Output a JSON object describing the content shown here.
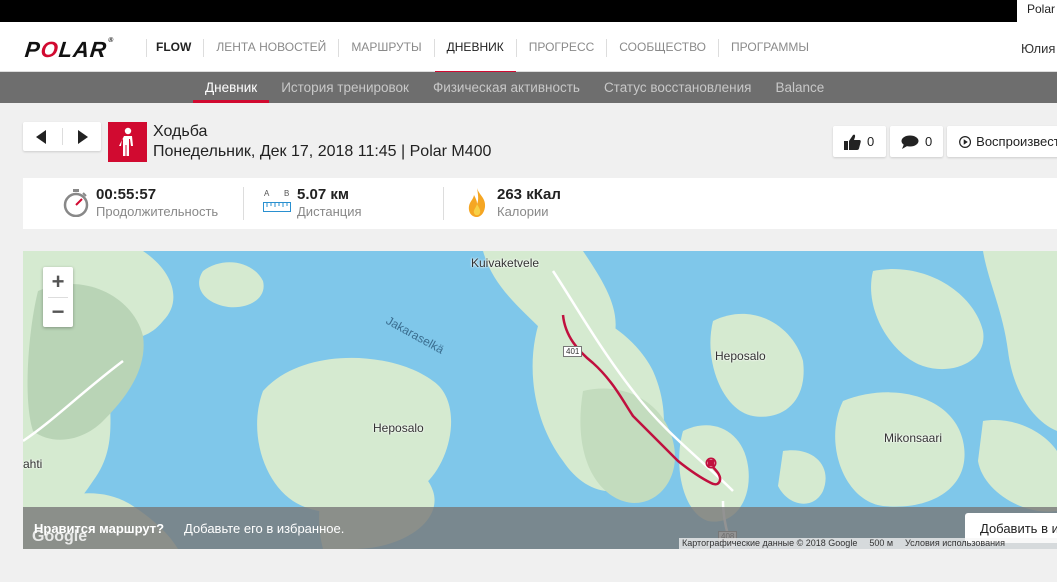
{
  "topbar": {
    "tab_label": "Polar"
  },
  "nav": {
    "brand": "POLAR",
    "items": [
      "FLOW",
      "ЛЕНТА НОВОСТЕЙ",
      "МАРШРУТЫ",
      "ДНЕВНИК",
      "ПРОГРЕСС",
      "СООБЩЕСТВО",
      "ПРОГРАММЫ"
    ],
    "active": "ДНЕВНИК",
    "user": "Юлия"
  },
  "subnav": {
    "items": [
      "Дневник",
      "История тренировок",
      "Физическая активность",
      "Статус восстановления",
      "Balance"
    ],
    "active": "Дневник"
  },
  "session": {
    "sport": "Ходьба",
    "date_device": "Понедельник, Дек 17, 2018 11:45 | Polar M400",
    "likes": "0",
    "comments": "0",
    "play_label": "Воспроизвести"
  },
  "summary": {
    "duration_value": "00:55:57",
    "duration_label": "Продолжительность",
    "distance_icon_a": "A",
    "distance_icon_b": "B",
    "distance_value": "5.07 км",
    "distance_label": "Дистанция",
    "calories_value": "263 кКал",
    "calories_label": "Калории"
  },
  "map": {
    "zoom_in": "+",
    "zoom_out": "−",
    "labels": {
      "kuivaketvele": "Kuivaketvele",
      "jakaraselka": "Jakaraselkä",
      "heposalo_left": "Heposalo",
      "heposalo_right": "Heposalo",
      "mikonsaari": "Mikonsaari",
      "ahti": "ahti",
      "road_top": "401",
      "road_bottom": "408"
    },
    "google_logo": "Google",
    "credit_data": "Картографические данные © 2018 Google",
    "credit_scale": "500 м",
    "credit_terms": "Условия использования",
    "prompt_question": "Нравится маршрут?",
    "prompt_action": "Добавьте его в избранное.",
    "favorite_label": "Добавить в избранное",
    "colors": {
      "water": "#7fc7ea",
      "land": "#d5ead0",
      "route": "#c0103e"
    }
  }
}
